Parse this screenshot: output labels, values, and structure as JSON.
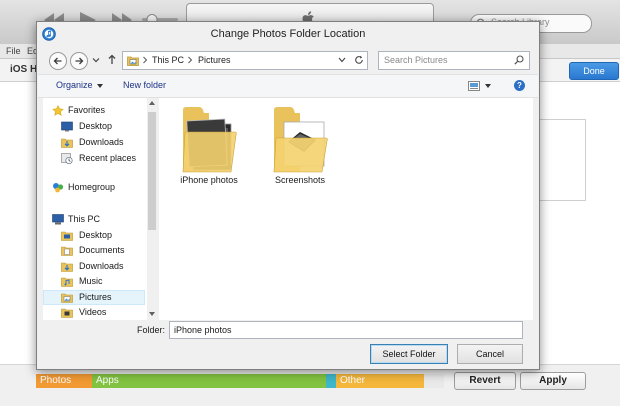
{
  "itunes": {
    "search_placeholder": "Search Library",
    "menu": [
      "File",
      "Ed"
    ],
    "device_title": "iOS H",
    "done_label": "Done",
    "capacity": [
      {
        "label": "Photos",
        "color": "#f29a33"
      },
      {
        "label": "Apps",
        "color": "#82c341"
      },
      {
        "label": "",
        "color": "#3db7c9"
      },
      {
        "label": "Other",
        "color": "#f4b73c"
      }
    ],
    "revert_label": "Revert",
    "apply_label": "Apply"
  },
  "dialog": {
    "title": "Change Photos Folder Location",
    "breadcrumb": [
      "This PC",
      "Pictures"
    ],
    "search_placeholder": "Search Pictures",
    "organize_label": "Organize",
    "new_folder_label": "New folder",
    "help_glyph": "?",
    "nav": [
      {
        "label": "Favorites",
        "icon": "star-icon"
      },
      {
        "label": "Desktop",
        "icon": "desktop-icon"
      },
      {
        "label": "Downloads",
        "icon": "downloads-icon"
      },
      {
        "label": "Recent places",
        "icon": "recent-places-icon"
      },
      {
        "label": "Homegroup",
        "icon": "homegroup-icon"
      },
      {
        "label": "This PC",
        "icon": "computer-icon"
      },
      {
        "label": "Desktop",
        "icon": "desktop-icon"
      },
      {
        "label": "Documents",
        "icon": "documents-icon"
      },
      {
        "label": "Downloads",
        "icon": "downloads-icon"
      },
      {
        "label": "Music",
        "icon": "music-icon"
      },
      {
        "label": "Pictures",
        "icon": "pictures-icon"
      },
      {
        "label": "Videos",
        "icon": "videos-icon"
      }
    ],
    "selected_nav": "Pictures",
    "files": [
      {
        "name": "iPhone photos",
        "icon": "folder-icon"
      },
      {
        "name": "Screenshots",
        "icon": "folder-icon"
      }
    ],
    "folder_label": "Folder:",
    "folder_value": "iPhone photos",
    "select_label": "Select Folder",
    "cancel_label": "Cancel"
  }
}
